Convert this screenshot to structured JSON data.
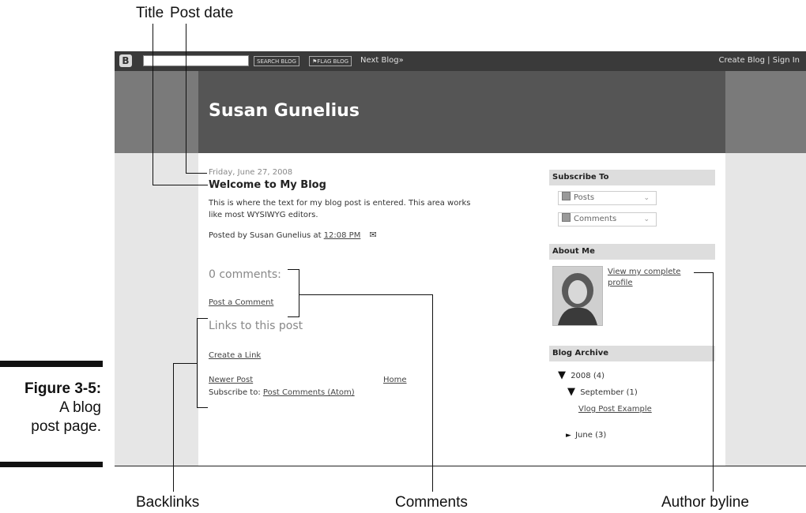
{
  "callouts": {
    "title": "Title",
    "post_date": "Post date",
    "backlinks": "Backlinks",
    "comments": "Comments",
    "author_byline": "Author byline"
  },
  "figure": {
    "label": "Figure 3-5:",
    "caption_line1": "A blog",
    "caption_line2": "post page."
  },
  "navbar": {
    "logo_icon": "blogger-icon",
    "search_button": "SEARCH BLOG",
    "flag_button": "FLAG BLOG",
    "next_blog": "Next Blog»",
    "right_links": "Create Blog | Sign In"
  },
  "header": {
    "blog_title": "Susan Gunelius"
  },
  "post": {
    "date": "Friday, June 27, 2008",
    "title": "Welcome to My Blog",
    "body_line1": "This is where the text for my blog post is entered. This area works",
    "body_line2": "like most WYSIWYG editors.",
    "posted_by": "Posted by Susan Gunelius at",
    "time": "12:08 PM",
    "email_icon": "email-post-icon"
  },
  "comments": {
    "heading": "0 comments:",
    "post_comment": "Post a Comment"
  },
  "backlinks": {
    "heading": "Links to this post",
    "create_link": "Create a Link"
  },
  "pager": {
    "newer": "Newer Post",
    "home": "Home",
    "subscribe_label": "Subscribe to:",
    "subscribe_link": "Post Comments (Atom)"
  },
  "sidebar": {
    "subscribe_heading": "Subscribe To",
    "feed_posts": "Posts",
    "feed_comments": "Comments",
    "about_heading": "About Me",
    "profile_line1": "View my complete",
    "profile_line2": "profile",
    "archive_heading": "Blog Archive",
    "archive_year": "2008 (4)",
    "archive_month": "September (1)",
    "archive_post": "Vlog Post Example",
    "archive_june": "June (3)"
  }
}
